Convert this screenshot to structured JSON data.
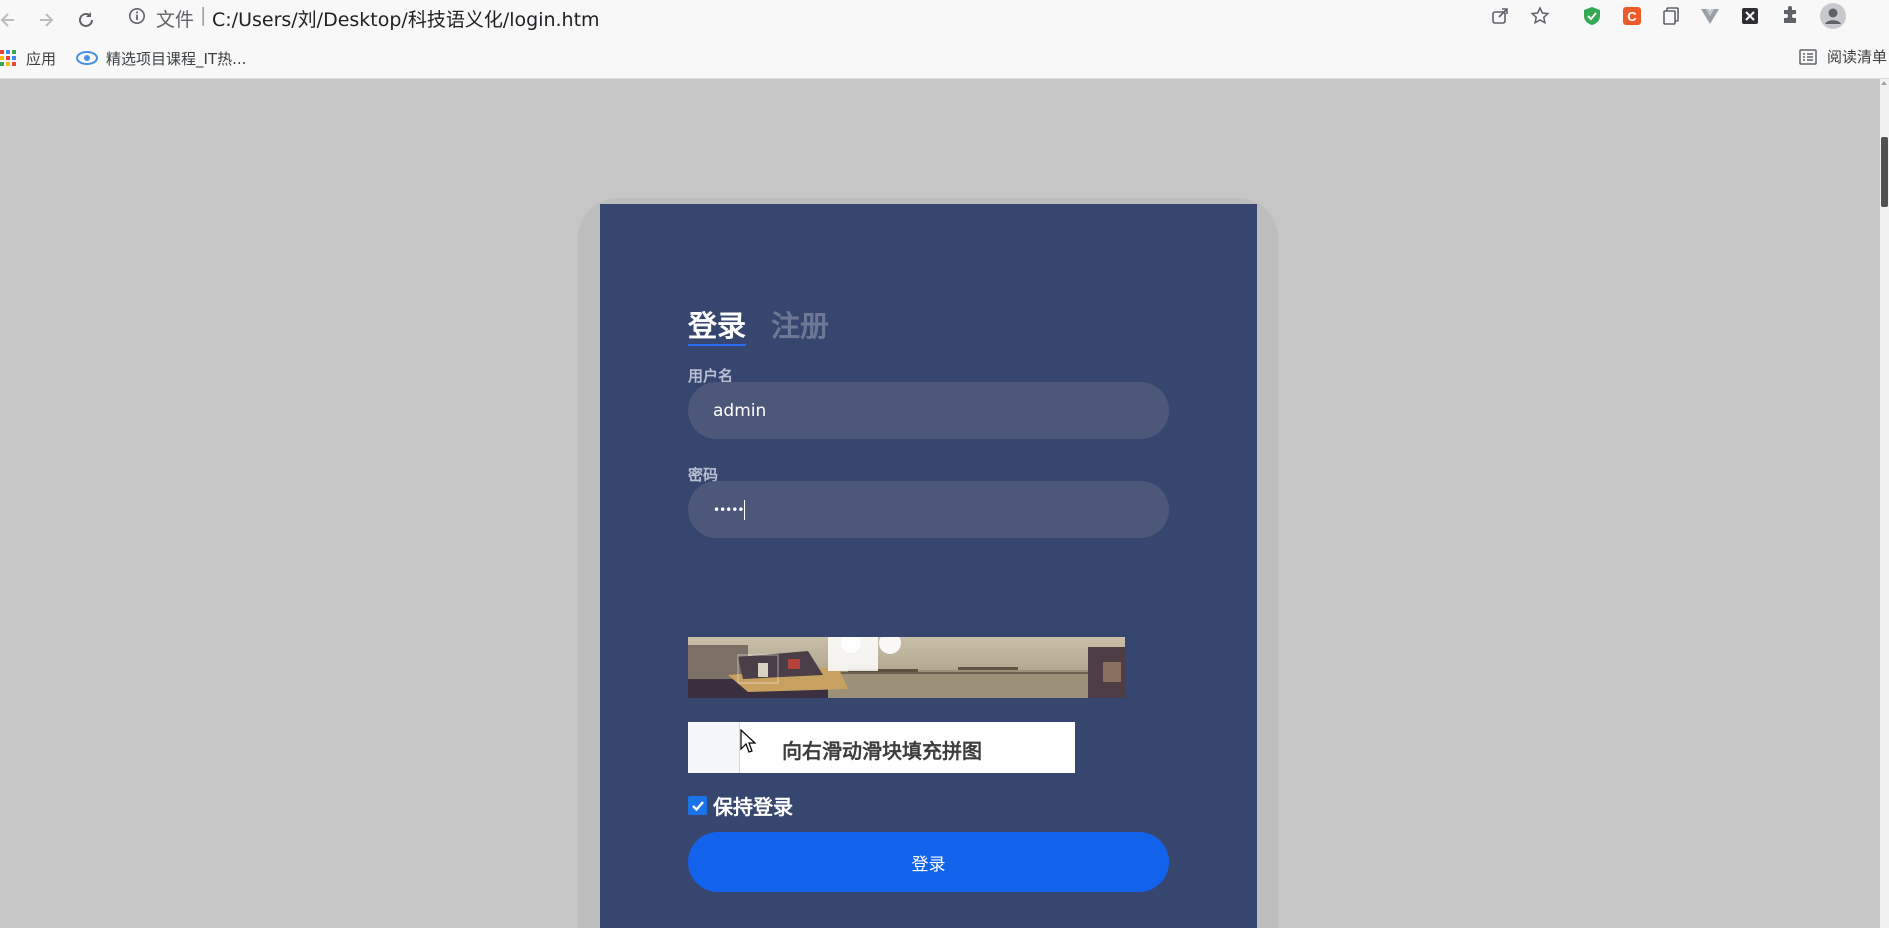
{
  "browser": {
    "address": {
      "scheme_label": "文件",
      "separator": "|",
      "url": "C:/Users/刘/Desktop/科技语义化/login.htm"
    },
    "bookmarks": [
      {
        "label": "应用",
        "icon": "apps-grid-icon"
      },
      {
        "label": "精选项目课程_IT热...",
        "icon": "site-favicon-icon"
      }
    ],
    "reading_list_label": "阅读清单"
  },
  "login": {
    "tabs": [
      {
        "label": "登录",
        "active": true
      },
      {
        "label": "注册",
        "active": false
      }
    ],
    "username": {
      "label": "用户名",
      "value": "admin"
    },
    "password": {
      "label": "密码",
      "masked_value": "•••••"
    },
    "captcha": {
      "slider_text": "向右滑动滑块填充拼图"
    },
    "remember": {
      "label": "保持登录",
      "checked": true
    },
    "submit_label": "登录"
  },
  "colors": {
    "card_bg": "#37466e",
    "field_bg": "#4d5779",
    "button_bg": "#1262ec",
    "page_bg": "#c6c6c6"
  }
}
